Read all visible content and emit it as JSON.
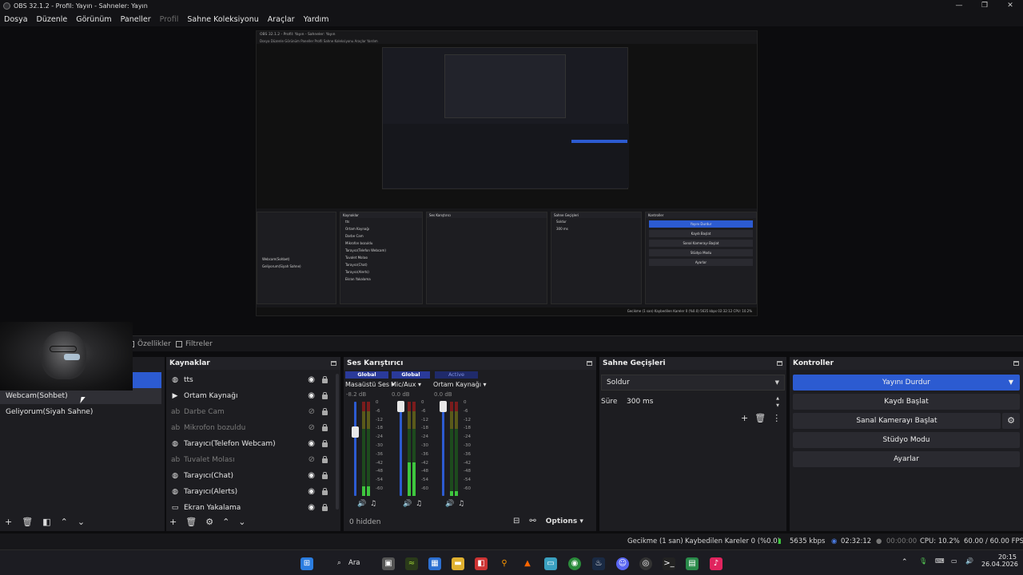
{
  "window": {
    "title": "OBS 32.1.2 - Profil: Yayın - Sahneler: Yayın",
    "controls": [
      "—",
      "❐",
      "✕"
    ]
  },
  "menu": [
    "Dosya",
    "Düzenle",
    "Görünüm",
    "Paneller",
    "Profil",
    "Sahne Koleksiyonu",
    "Araçlar",
    "Yardım"
  ],
  "nested_preview": {
    "title": "OBS 32.1.2 - Profil: Yayın - Sahneler: Yayın",
    "menu": "Dosya  Düzenle  Görünüm  Paneller  Profil  Sahne Koleksiyonu  Araçlar  Yardım",
    "scenes": [
      "Webcam(Sohbet)",
      "Geliyorum(Siyah Sahne)"
    ],
    "sources_title": "Kaynaklar",
    "sources": [
      "tts",
      "Ortam Kaynağı",
      "Darbe Cam",
      "Mikrofon bozuldu",
      "Tarayıcı(Telefon Webcam)",
      "Tuvalet Molası",
      "Tarayıcı(Chat)",
      "Tarayıcı(Alerts)",
      "Ekran Yakalama"
    ],
    "mixer_title": "Ses Karıştırıcı",
    "transitions_title": "Sahne Geçişleri",
    "transition": "Soldur",
    "duration": "300 ms",
    "controls_title": "Kontroller",
    "buttons": [
      "Yayını Durdur",
      "Kaydı Başlat",
      "Sanal Kamerayı Başlat",
      "Stüdyo Modu",
      "Ayarlar"
    ],
    "status": "Gecikme (1 san)   Kaybedilen Kareler 0 (%0.0)   5635 kbps   02:32:12   CPU: 10.2%"
  },
  "tabs": {
    "properties": "Özellikler",
    "filters": "Filtreler"
  },
  "scenes": {
    "items": [
      "Webcam(Sohbet)",
      "Geliyorum(Siyah Sahne)"
    ]
  },
  "sources": {
    "title": "Kaynaklar",
    "items": [
      {
        "label": "tts",
        "icon": "browser-icon",
        "visible": true
      },
      {
        "label": "Ortam Kaynağı",
        "icon": "media-play-icon",
        "visible": true
      },
      {
        "label": "Darbe Cam",
        "icon": "text-icon",
        "visible": false
      },
      {
        "label": "Mikrofon bozuldu",
        "icon": "text-icon",
        "visible": false
      },
      {
        "label": "Tarayıcı(Telefon Webcam)",
        "icon": "browser-icon",
        "visible": true
      },
      {
        "label": "Tuvalet Molası",
        "icon": "text-icon",
        "visible": false
      },
      {
        "label": "Tarayıcı(Chat)",
        "icon": "browser-icon",
        "visible": true
      },
      {
        "label": "Tarayıcı(Alerts)",
        "icon": "browser-icon",
        "visible": true
      },
      {
        "label": "Ekran Yakalama",
        "icon": "monitor-icon",
        "visible": true
      }
    ]
  },
  "mixer": {
    "title": "Ses Karıştırıcı",
    "channels": [
      {
        "header": "Global",
        "name": "Masaüstü Ses",
        "db": "-8.2 dB",
        "level": 0.1,
        "fader": 0.68
      },
      {
        "header": "Global",
        "name": "Mic/Aux",
        "db": "0.0 dB",
        "level": 0.36,
        "fader": 0.95
      },
      {
        "header": "Active",
        "name": "Ortam Kaynağı",
        "db": "0.0 dB",
        "level": 0.05,
        "fader": 0.95
      }
    ],
    "scale": [
      "0",
      "-6",
      "-12",
      "-18",
      "-24",
      "-30",
      "-36",
      "-42",
      "-48",
      "-54",
      "-60"
    ],
    "hidden": "0 hidden",
    "options": "Options"
  },
  "transitions": {
    "title": "Sahne Geçişleri",
    "selected": "Soldur",
    "duration_label": "Süre",
    "duration_value": "300 ms"
  },
  "controls": {
    "title": "Kontroller",
    "stop_stream": "Yayını Durdur",
    "start_record": "Kaydı Başlat",
    "virtual_cam": "Sanal Kamerayı Başlat",
    "studio_mode": "Stüdyo Modu",
    "settings": "Ayarlar"
  },
  "status": {
    "delay": "Gecikme (1 san)",
    "dropped": "Kaybedilen Kareler 0 (%0.0)",
    "bitrate": "5635 kbps",
    "stream_time": "02:32:12",
    "record_time": "00:00:00",
    "cpu": "CPU: 10.2%",
    "fps": "60.00 / 60.00 FPS"
  },
  "taskbar": {
    "search": "Ara",
    "time": "20:15",
    "date": "26.04.2026"
  }
}
